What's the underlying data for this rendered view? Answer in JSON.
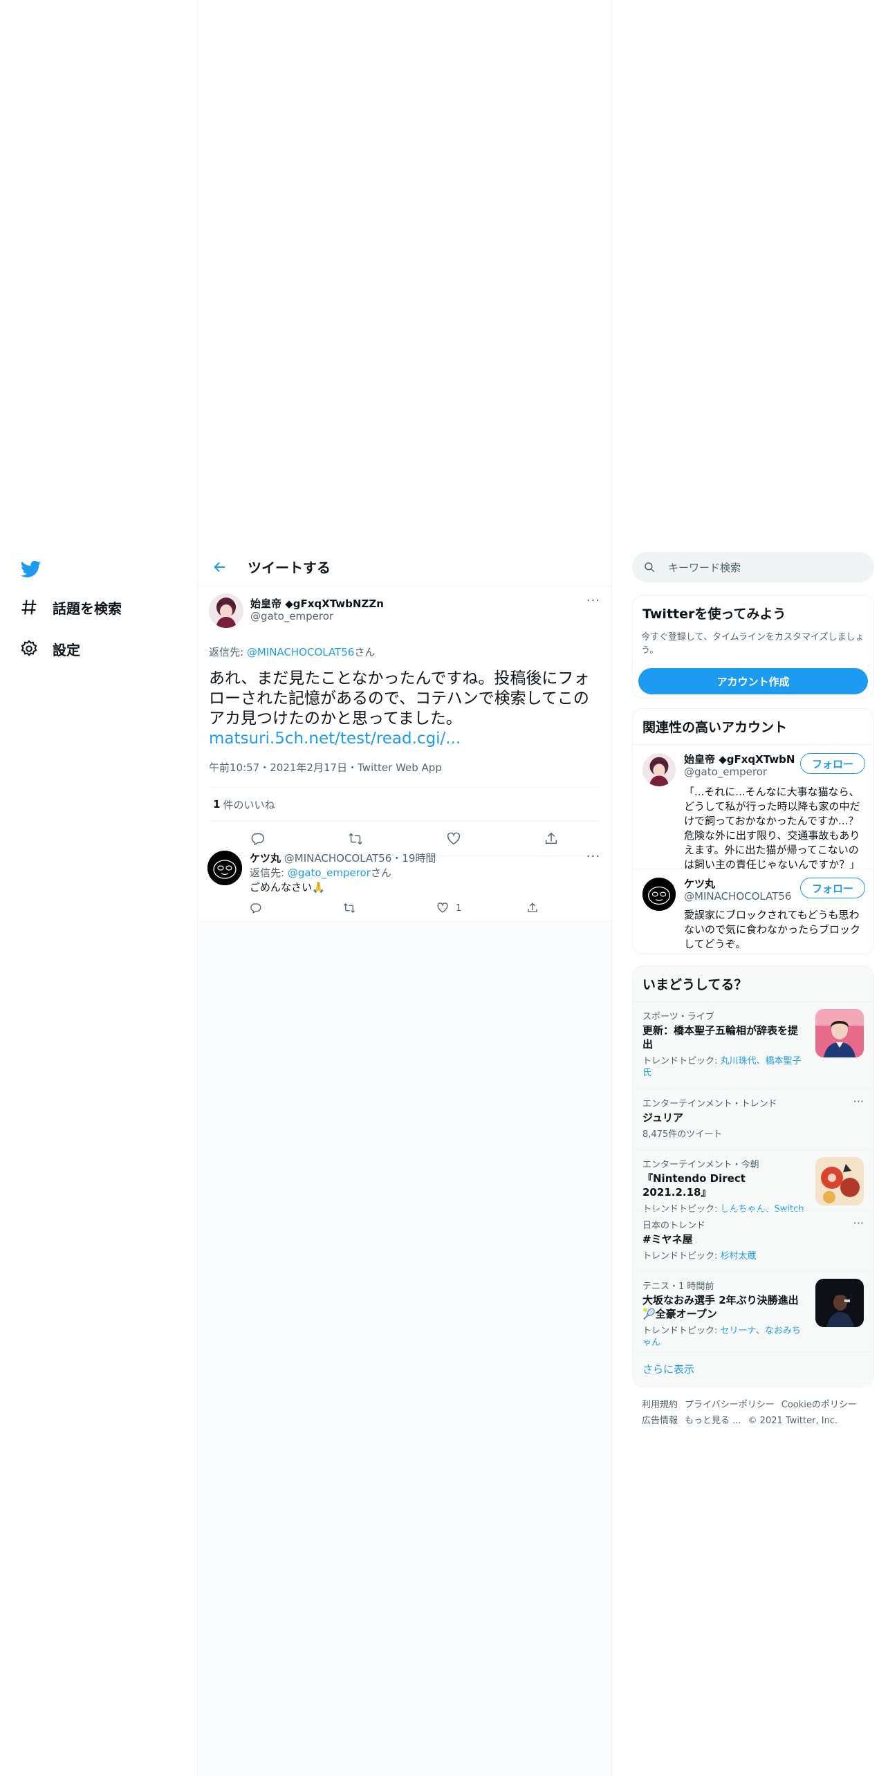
{
  "nav": {
    "items": [
      {
        "label": "話題を検索",
        "icon": "hashtag-icon"
      },
      {
        "label": "設定",
        "icon": "gear-icon"
      }
    ]
  },
  "header": {
    "title": "ツイートする"
  },
  "main_tweet": {
    "name": "始皇帝 ◆gFxqXTwbNZZn",
    "handle": "@gato_emperor",
    "reply_prefix": "返信先: ",
    "reply_to": "@MINACHOCOLAT56",
    "reply_suffix": "さん",
    "text": "あれ、まだ見たことなかったんですね。投稿後にフォローされた記憶があるので、コテハンで検索してこのアカ見つけたのかと思ってました。",
    "link": "matsuri.5ch.net/test/read.cgi/...",
    "meta": "午前10:57・2021年2月17日・Twitter Web App",
    "likes_count": "1",
    "likes_label": "件のいいね"
  },
  "reply": {
    "name": "ケツ丸",
    "handle": "@MINACHOCOLAT56",
    "time": "・19時間",
    "reply_prefix": "返信先: ",
    "reply_to": "@gato_emperor",
    "reply_suffix": "さん",
    "text": "ごめんなさい🙏",
    "like_count": "1"
  },
  "search": {
    "placeholder": "キーワード検索"
  },
  "signup": {
    "title": "Twitterを使ってみよう",
    "desc": "今すぐ登録して、タイムラインをカスタマイズしましょう。",
    "button": "アカウント作成"
  },
  "related": {
    "title": "関連性の高いアカウント",
    "follow_label": "フォロー",
    "accounts": [
      {
        "name": "始皇帝 ◆gFxqXTwbNZZn",
        "handle": "@gato_emperor",
        "bio": "「...それに...そんなに大事な猫なら、どうして私が行った時以降も家の中だけで飼っておかなかったんですか...？危険な外に出す限り、交通事故もありえます。外に出た猫が帰ってこないのは飼い主の責任じゃないんですか？」"
      },
      {
        "name": "ケツ丸",
        "handle": "@MINACHOCOLAT56",
        "bio": "愛誤家にブロックされてもどうも思わないので気に食わなかったらブロックしてどうぞ。"
      }
    ]
  },
  "trends": {
    "title": "いまどうしてる？",
    "items": [
      {
        "category": "スポーツ・ライブ",
        "title": "更新：橋本聖子五輪相が辞表を提出",
        "sub_prefix": "トレンドトピック: ",
        "sub_links": "丸川珠代、橋本聖子氏"
      },
      {
        "category": "エンターテインメント・トレンド",
        "title": "ジュリア",
        "sub_plain": "8,475件のツイート"
      },
      {
        "category": "エンターテインメント・今朝",
        "title": "『Nintendo Direct 2021.2.18』",
        "sub_prefix": "トレンドトピック: ",
        "sub_links": "しんちゃん、Switch"
      },
      {
        "category": "日本のトレンド",
        "title": "#ミヤネ屋",
        "sub_prefix": "トレンドトピック: ",
        "sub_links": "杉村太蔵"
      },
      {
        "category": "テニス・1 時間前",
        "title": "大坂なおみ選手 2年ぶり決勝進出🎾全豪オープン",
        "sub_prefix": "トレンドトピック: ",
        "sub_links": "セリーナ、なおみちゃん"
      }
    ],
    "show_more": "さらに表示"
  },
  "footer": {
    "links": [
      "利用規約",
      "プライバシーポリシー",
      "Cookieのポリシー",
      "広告情報",
      "もっと見る ..."
    ],
    "copyright": "© 2021 Twitter, Inc."
  },
  "colors": {
    "accent": "#1d9bf0",
    "text": "#0f1419",
    "secondary": "#536471",
    "border": "#eff3f4"
  }
}
